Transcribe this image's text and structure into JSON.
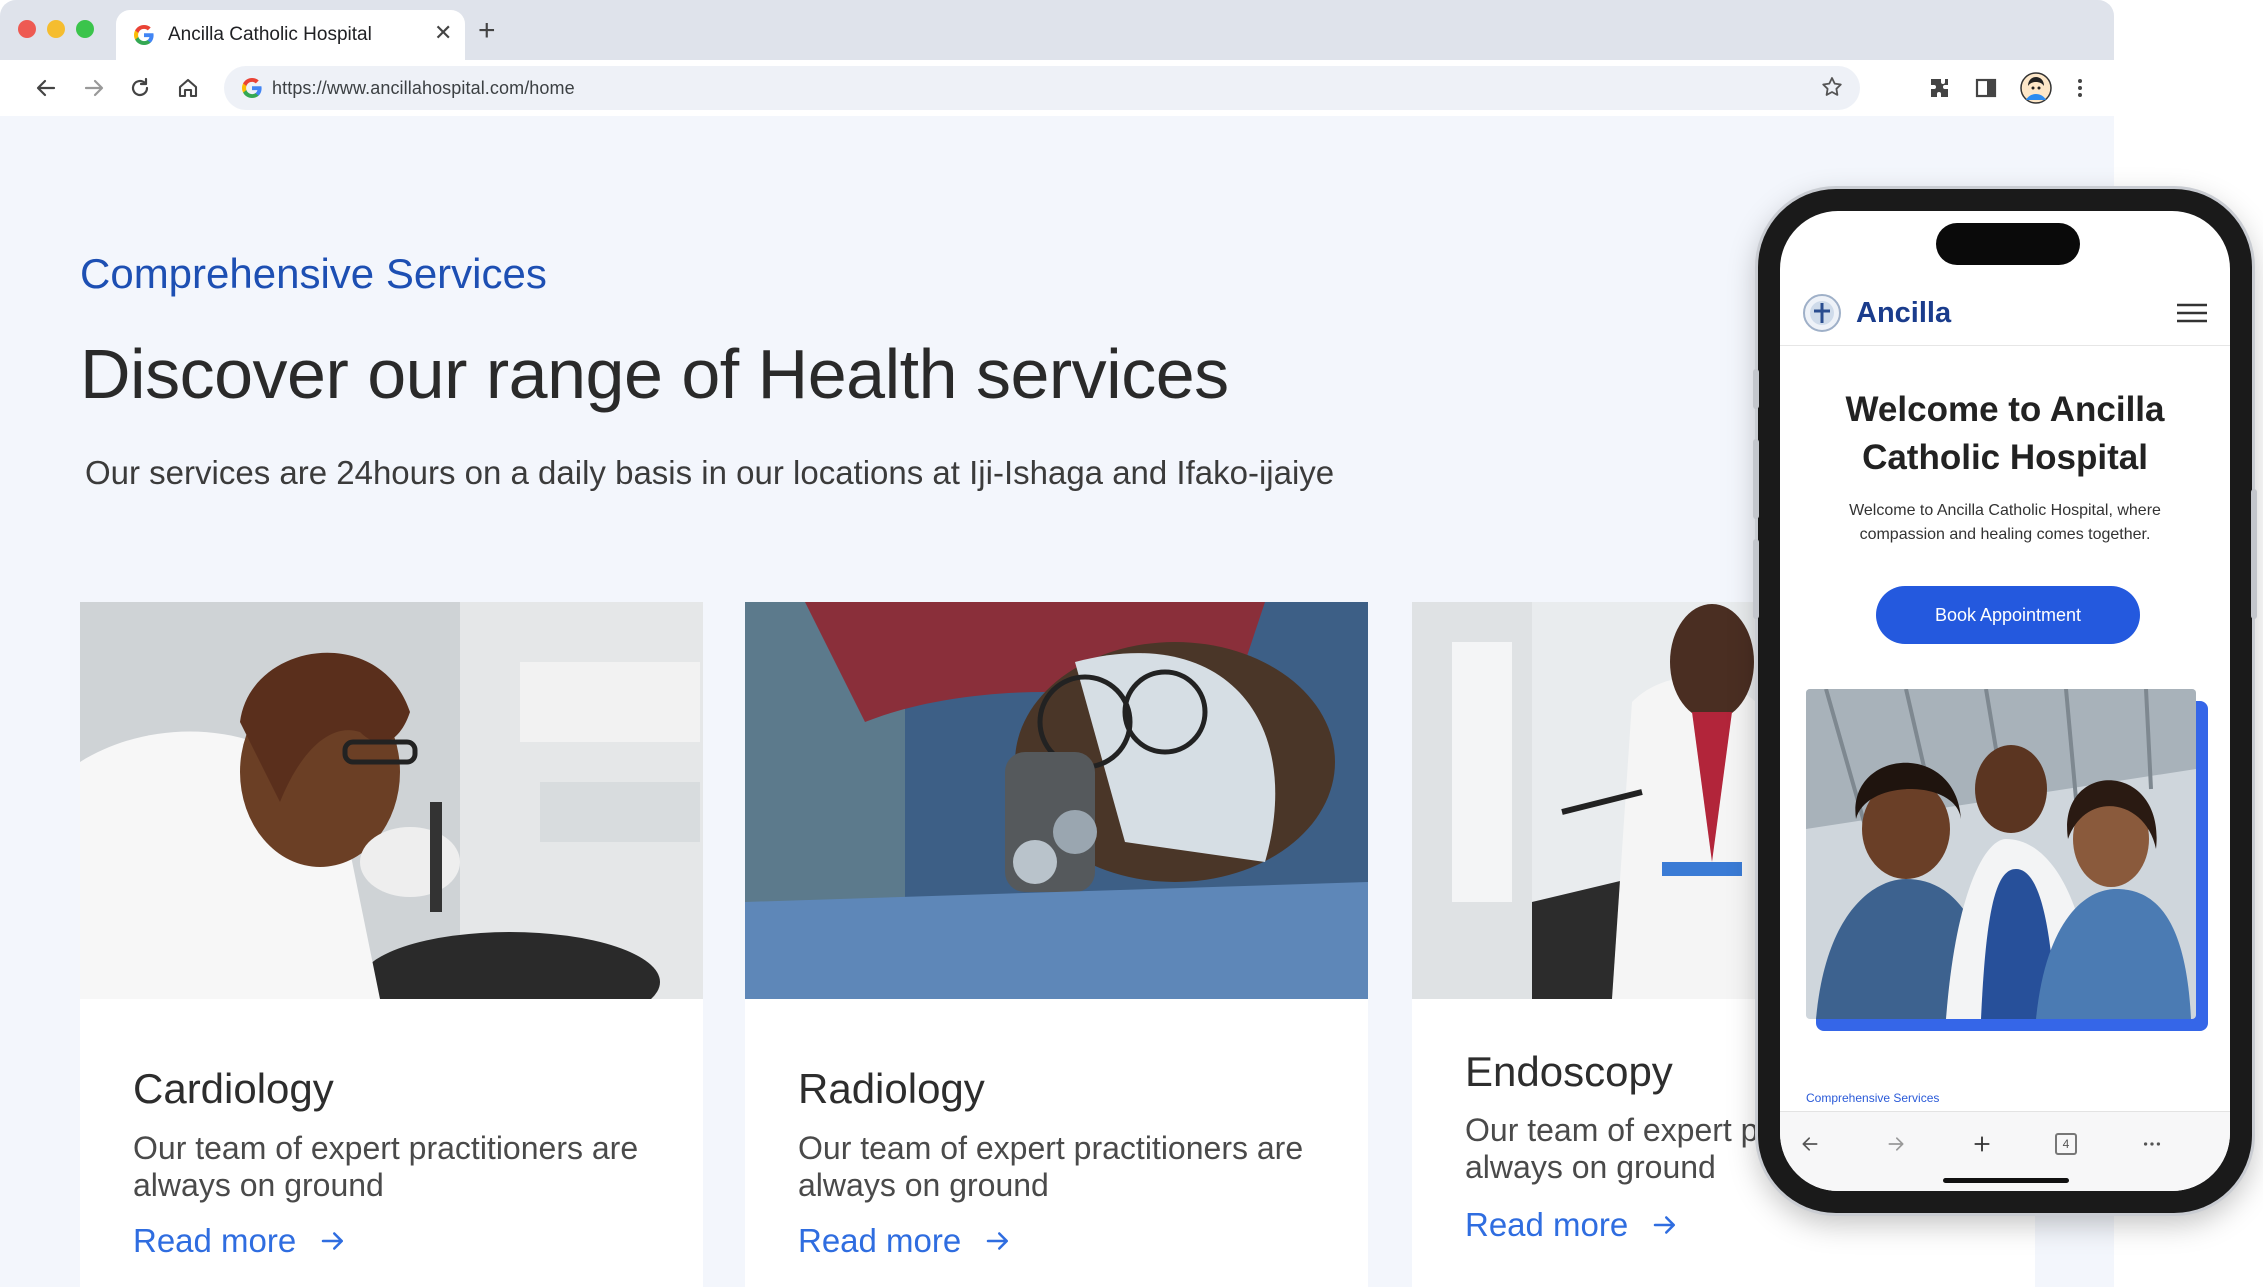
{
  "browser": {
    "tab_title": "Ancilla Catholic Hospital",
    "url": "https://www.ancillahospital.com/home",
    "icons": [
      "back-icon",
      "forward-icon",
      "reload-icon",
      "home-icon",
      "star-icon",
      "extensions-icon",
      "side-panel-icon",
      "avatar",
      "more-icon"
    ]
  },
  "page": {
    "eyebrow": "Comprehensive Services",
    "headline": "Discover our range of Health services",
    "subtext": "Our services are 24hours on a daily basis in our locations at Iji-Ishaga and Ifako-ijaiye",
    "cards": [
      {
        "title": "Cardiology",
        "desc": "Our team of expert practitioners are always on ground",
        "link": "Read more"
      },
      {
        "title": "Radiology",
        "desc": "Our team of expert practitioners are always on ground",
        "link": "Read more"
      },
      {
        "title": "Endoscopy",
        "desc": "Our team of expert practitioners are always on ground",
        "link": "Read more"
      }
    ]
  },
  "mobile": {
    "brand": "Ancilla",
    "title": "Welcome to Ancilla Catholic Hospital",
    "subtitle": "Welcome to Ancilla Catholic Hospital, where compassion and healing comes together.",
    "cta": "Book Appointment",
    "eyebrow": "Comprehensive Services",
    "tab_count": "4"
  },
  "colors": {
    "accent_blue": "#1d4fb3",
    "link_blue": "#2f6de0",
    "button_blue": "#2459de",
    "page_bg": "#f3f6fc"
  }
}
